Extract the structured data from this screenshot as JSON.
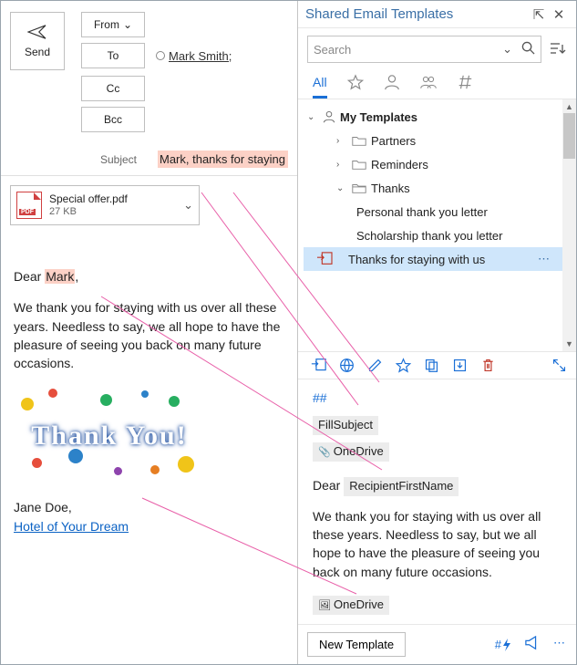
{
  "compose": {
    "send": "Send",
    "from": "From",
    "to": "To",
    "cc": "Cc",
    "bcc": "Bcc",
    "recipient": "Mark Smith;",
    "subject_label": "Subject",
    "subject_value": "Mark, thanks for staying",
    "attachment": {
      "name": "Special offer.pdf",
      "size": "27 KB"
    },
    "body_greeting_prefix": "Dear ",
    "body_greeting_name": "Mark",
    "body_greeting_suffix": ",",
    "body_text": "We thank you for staying with us over all these years. Needless to say, we all hope to have the pleasure of seeing you back on many future occasions.",
    "image_text": "Thank You!",
    "signature_name": "Jane Doe,",
    "signature_link": "Hotel of Your Dream"
  },
  "panel": {
    "title": "Shared Email Templates",
    "search_placeholder": "Search",
    "tabs": {
      "all": "All"
    },
    "tree": {
      "root": "My Templates",
      "folders": [
        "Partners",
        "Reminders",
        "Thanks"
      ],
      "thanks_items": [
        "Personal thank you letter",
        "Scholarship thank you letter",
        "Thanks for staying with us"
      ]
    },
    "preview": {
      "macro": "##",
      "fill_subject": "FillSubject",
      "attach_chip": "OneDrive",
      "greeting_prefix": "Dear ",
      "recipient_macro": "RecipientFirstName",
      "body": "We thank you for staying with us over all these years. Needless  to say, but we all hope to have the pleasure of seeing you back on many future occasions.",
      "image_chip": "OneDrive"
    },
    "new_template": "New Template",
    "footer_hash": "#"
  }
}
